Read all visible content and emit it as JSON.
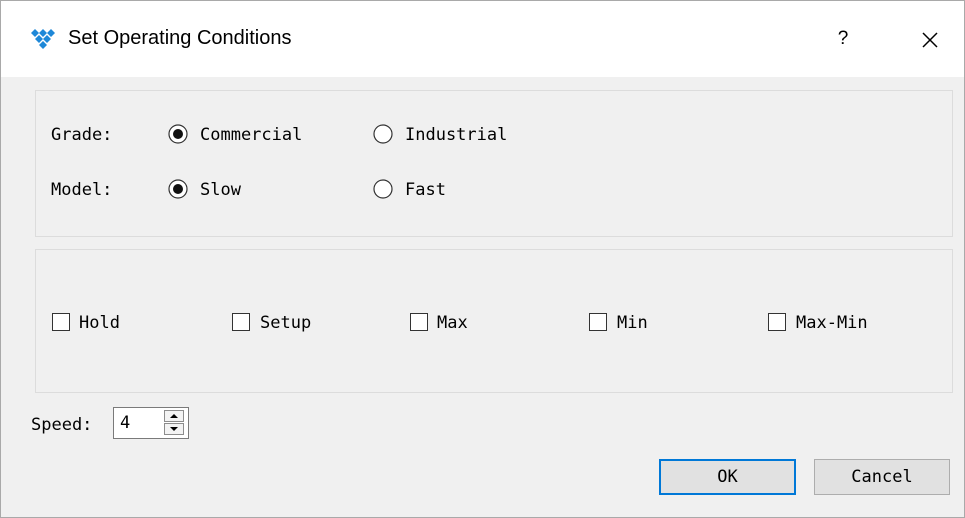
{
  "window": {
    "title": "Set Operating Conditions",
    "help_label": "?",
    "icon": "app-logo-icon",
    "close_icon": "close-icon"
  },
  "grade": {
    "label": "Grade:",
    "options": [
      {
        "label": "Commercial",
        "selected": true
      },
      {
        "label": "Industrial",
        "selected": false
      }
    ]
  },
  "model": {
    "label": "Model:",
    "options": [
      {
        "label": "Slow",
        "selected": true
      },
      {
        "label": "Fast",
        "selected": false
      }
    ]
  },
  "analysis": {
    "checkboxes": [
      {
        "label": "Hold",
        "checked": false
      },
      {
        "label": "Setup",
        "checked": false
      },
      {
        "label": "Max",
        "checked": false
      },
      {
        "label": "Min",
        "checked": false
      },
      {
        "label": "Max-Min",
        "checked": false
      }
    ]
  },
  "speed": {
    "label": "Speed:",
    "value": "4"
  },
  "buttons": {
    "ok": "OK",
    "cancel": "Cancel"
  },
  "colors": {
    "accent": "#0078d7",
    "dialog_bg": "#f0f0f0",
    "logo": "#1e88d8"
  }
}
